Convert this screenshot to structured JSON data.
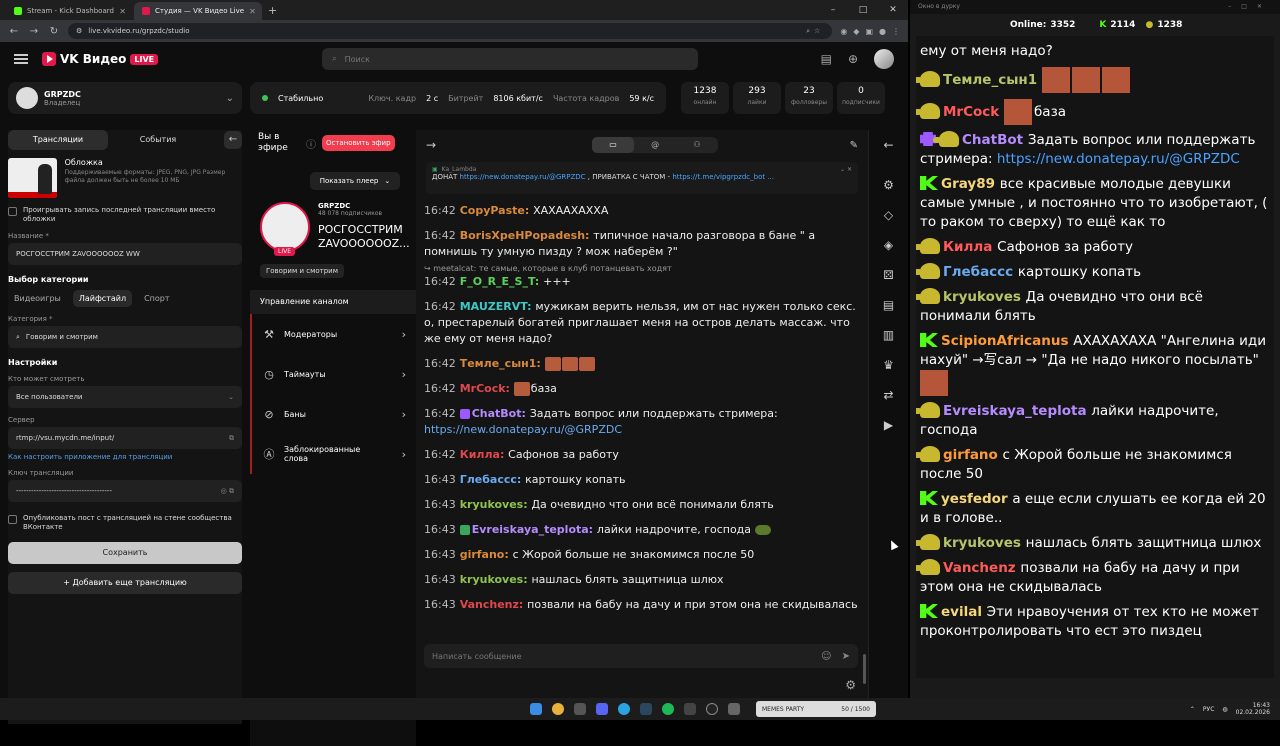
{
  "browser": {
    "tabs": [
      {
        "title": "Stream - Kick Dashboard",
        "color": "#53fc18"
      },
      {
        "title": "Студия — VK Видео Live",
        "color": "#e0184c"
      }
    ],
    "newtab": "+",
    "url": "live.vkvideo.ru/grpzdc/studio"
  },
  "topnav": {
    "logo": "VK Видео",
    "live_badge": "LIVE",
    "search_placeholder": "Поиск"
  },
  "channel": {
    "name": "GRPZDC",
    "role": "Владелец"
  },
  "status": {
    "state": "Стабильно",
    "keyframe_label": "Ключ. кадр",
    "keyframe": "2 с",
    "bitrate_label": "Битрейт",
    "bitrate": "8106 кбит/с",
    "fps_label": "Частота кадров",
    "fps": "59 к/с"
  },
  "stats": [
    {
      "value": "1238",
      "label": "онлайн"
    },
    {
      "value": "293",
      "label": "лайки"
    },
    {
      "value": "23",
      "label": "фолловеры"
    },
    {
      "value": "0",
      "label": "подписчики"
    }
  ],
  "settings": {
    "tab_broadcasts": "Трансляции",
    "tab_events": "События",
    "cover_title": "Обложка",
    "cover_hint": "Поддерживаемые форматы: JPEG, PNG, JPG Размер файла должен быть не более 10 МБ",
    "replay_label": "Проигрывать запись последней трансляции вместо обложки",
    "name_label": "Название *",
    "name_value": "РОСГОССТРИМ ZAVOOOOOOZ WW",
    "category_section": "Выбор категории",
    "cats": [
      "Видеоигры",
      "Лайфстайл",
      "Спорт"
    ],
    "category_label": "Категория *",
    "category_value": "Говорим и смотрим",
    "settings_section": "Настройки",
    "who_label": "Кто может смотреть",
    "who_value": "Все пользователи",
    "server_label": "Сервер",
    "server_value": "rtmp://vsu.mycdn.me/input/",
    "help_link": "Как настроить приложение для трансляции",
    "key_label": "Ключ трансляции",
    "key_value": "--------------------------------------",
    "publish_label": "Опубликовать пост с трансляцией на стене сообщества ВКонтакте",
    "save": "Сохранить",
    "add": "Добавить еще трансляцию"
  },
  "center": {
    "on_air": "Вы в эфире",
    "stop": "Остановить эфир",
    "show_player": "Показать плеер",
    "channel": "GRPZDC",
    "subs": "48 078 подписчиков",
    "live": "LIVE",
    "title": "РОСГОССТРИМ\nZAVOOOOOOZ...",
    "category_chip": "Говорим и смотрим",
    "mgmt": "Управление каналом",
    "menu": [
      "Модераторы",
      "Таймауты",
      "Баны",
      "Заблокированные слова"
    ]
  },
  "pinned": {
    "author": "Ka_Lambda",
    "text1": "ДОНАТ ",
    "link1": "https://new.donatepay.ru/@GRPZDC",
    "text2": " , ПРИВАТКА С ЧАТОМ - ",
    "link2": "https://t.me/vipgrpzdc_bot ..."
  },
  "chat": [
    {
      "t": "16:42",
      "u": "CopyPaste:",
      "c": "#d98a3e",
      "m": "ХАХААХАХХА"
    },
    {
      "t": "16:42",
      "u": "BorisXpeHPopadesh:",
      "c": "#d98a3e",
      "m": "типичное начало разговора в бане \" а помнишь ту умную пизду ? мож наберём ?\""
    },
    {
      "t": "16:42",
      "u": "F_O_R_E_S_T:",
      "c": "#5bd05b",
      "m": "+++",
      "reply": "meetalcat: те самые, которые в клуб потанцевать ходят"
    },
    {
      "t": "16:42",
      "u": "MAUZERVT:",
      "c": "#3ec9c9",
      "m": "мужикам верить нельзя, им от нас нужен только секс. о, престарелый богатей приглашает меня на остров делать массаж. что же ему от меня надо?"
    },
    {
      "t": "16:42",
      "u": "Темле_сын1:",
      "c": "#d98a3e",
      "m": ""
    },
    {
      "t": "16:42",
      "u": "MrCock:",
      "c": "#e0484c",
      "m": "база"
    },
    {
      "t": "16:42",
      "u": "ChatBot:",
      "c": "#b58cff",
      "m": "Задать вопрос или поддержать стримера: ",
      "link": "https://new.donatepay.ru/@GRPZDC"
    },
    {
      "t": "16:42",
      "u": "Килла:",
      "c": "#e0484c",
      "m": "Сафонов за работу"
    },
    {
      "t": "16:43",
      "u": "Глебасcс:",
      "c": "#6aaaf0",
      "m": "картошку копать"
    },
    {
      "t": "16:43",
      "u": "kryukoves:",
      "c": "#8ec34f",
      "m": "Да очевидно что они всё понимали блять"
    },
    {
      "t": "16:43",
      "u": "Evreiskaya_teplota:",
      "c": "#b58cff",
      "m": "лайки надрочите, господа"
    },
    {
      "t": "16:43",
      "u": "girfano:",
      "c": "#d98a3e",
      "m": "с Жорой больше не знакомимся после 50"
    },
    {
      "t": "16:43",
      "u": "kryukoves:",
      "c": "#8ec34f",
      "m": "нашлась блять защитница шлюх"
    },
    {
      "t": "16:43",
      "u": "Vanchenz:",
      "c": "#e0484c",
      "m": "позвали на бабу на дачу и при этом она не скидывалась"
    }
  ],
  "chat_input_placeholder": "Написать сообщение",
  "rightwin": {
    "title": "Окно в дурку",
    "online_label": "Online:",
    "online": "3352",
    "kick": "2114",
    "vk": "1238",
    "messages": [
      {
        "u": "",
        "c": "#fff",
        "m": "ему от меня надо?",
        "b": "none"
      },
      {
        "u": "Темле_сын1",
        "c": "#b8c46a",
        "m": "",
        "b": "chick",
        "faces": 3
      },
      {
        "u": "MrCock",
        "c": "#ff5a5a",
        "m": "база",
        "b": "chick",
        "faces": 1
      },
      {
        "u": "ChatBot",
        "c": "#b58cff",
        "m": "Задать вопрос или поддержать стримера: ",
        "link": "https://new.donatepay.ru/@GRPZDC",
        "b": "robot"
      },
      {
        "u": "Gray89",
        "c": "#f5d77a",
        "m": "все красивые молодые девушки самые умные , и постоянно что то изобретают, ( то раком то сверху) то ещё как то",
        "b": "kick"
      },
      {
        "u": "Килла",
        "c": "#ff5a5a",
        "m": "Сафонов за работу",
        "b": "chick"
      },
      {
        "u": "Глебасcс",
        "c": "#6aaaf0",
        "m": "картошку копать",
        "b": "chick"
      },
      {
        "u": "kryukoves",
        "c": "#b8c46a",
        "m": "Да очевидно что они всё понимали блять",
        "b": "chick"
      },
      {
        "u": "ScipionAfricanus",
        "c": "#ff9a3a",
        "m": "АХАХАХАХА \"Ангелина иди нахуй\" →写сал → \"Да не надо никого посылать\"",
        "b": "kick",
        "faces": 1
      },
      {
        "u": "Evreiskaya_teplota",
        "c": "#b58cff",
        "m": "лайки надрочите, господа",
        "b": "chick"
      },
      {
        "u": "girfano",
        "c": "#ff9a3a",
        "m": "с Жорой больше не знакомимся после 50",
        "b": "chick"
      },
      {
        "u": "yesfedor",
        "c": "#f5d77a",
        "m": "а еще если слушать ее когда ей 20 и в голове..",
        "b": "kick"
      },
      {
        "u": "kryukoves",
        "c": "#b8c46a",
        "m": "нашлась блять защитница шлюх",
        "b": "chick"
      },
      {
        "u": "Vanchenz",
        "c": "#ff5a5a",
        "m": "позвали на бабу на дачу и при этом она не скидывалась",
        "b": "chick"
      },
      {
        "u": "evilal",
        "c": "#f5d77a",
        "m": "Эти нравоучения от тех кто не может проконтролировать что ест это пиздец",
        "b": "kick"
      }
    ]
  },
  "taskbar": {
    "memes": "MEMES PARTY",
    "memes_count": "50 / 1500",
    "lang": "РУС",
    "time": "16:43",
    "date": "02.02.2026"
  },
  "colors": {
    "accent": "#e0184c",
    "kick": "#53fc18",
    "stop": "#f23d4f"
  }
}
